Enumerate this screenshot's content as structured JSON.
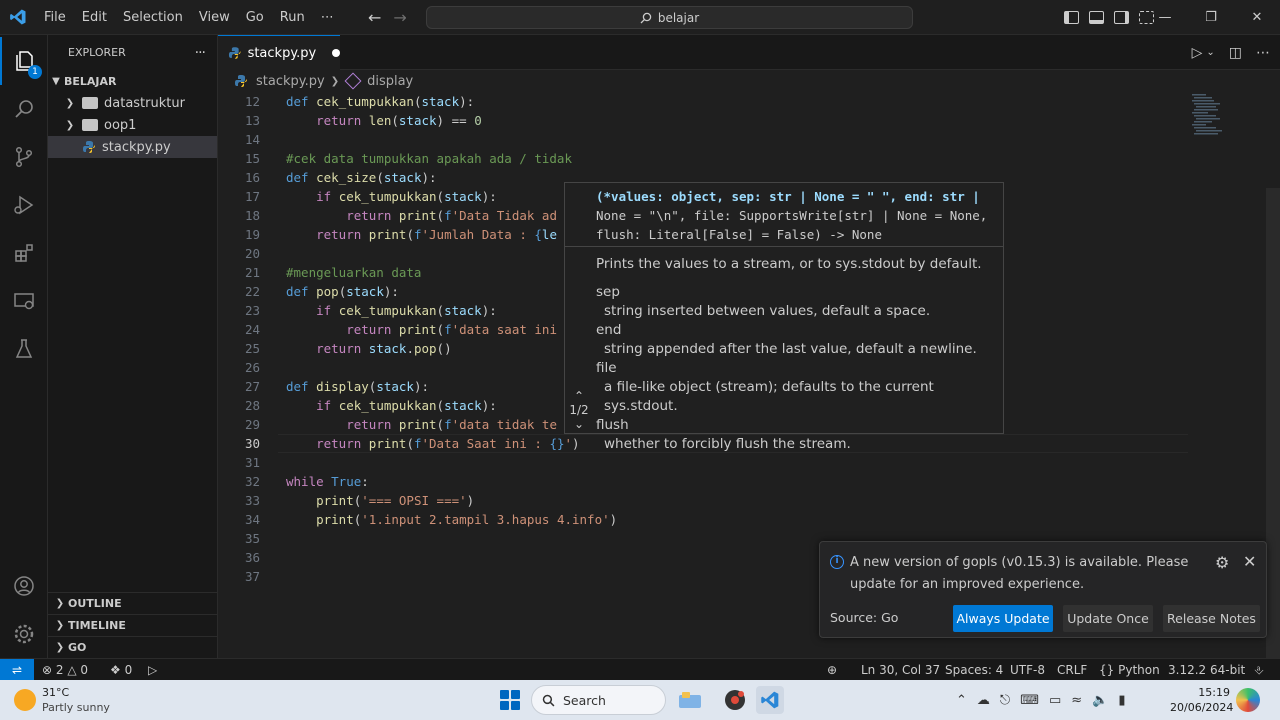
{
  "window": {
    "menu": [
      "File",
      "Edit",
      "Selection",
      "View",
      "Go",
      "Run",
      "⋯"
    ],
    "command_center": "belajar"
  },
  "activity": {
    "explorer_badge": "1"
  },
  "sidebar": {
    "title": "EXPLORER",
    "more": "···",
    "root": "BELAJAR",
    "items": [
      {
        "label": "datastruktur",
        "type": "folder"
      },
      {
        "label": "oop1",
        "type": "folder"
      },
      {
        "label": "stackpy.py",
        "type": "python-file"
      }
    ],
    "sections": [
      "OUTLINE",
      "TIMELINE",
      "GO"
    ]
  },
  "tab": {
    "label": "stackpy.py"
  },
  "breadcrumb": {
    "file": "stackpy.py",
    "symbol": "display"
  },
  "editor": {
    "cursor_line": 30,
    "lines": [
      {
        "n": "12",
        "tokens": [
          [
            "kw",
            "def "
          ],
          [
            "fn",
            "cek_tumpukkan"
          ],
          [
            "p",
            "("
          ],
          [
            "var",
            "stack"
          ],
          [
            "p",
            "):"
          ]
        ]
      },
      {
        "n": "13",
        "tokens": [
          [
            "p",
            "    "
          ],
          [
            "ctl",
            "return "
          ],
          [
            "fn",
            "len"
          ],
          [
            "p",
            "("
          ],
          [
            "var",
            "stack"
          ],
          [
            "p",
            ") == "
          ],
          [
            "num",
            "0"
          ]
        ]
      },
      {
        "n": "14",
        "tokens": []
      },
      {
        "n": "15",
        "tokens": [
          [
            "cmt",
            "#cek data tumpukkan apakah ada / tidak"
          ]
        ]
      },
      {
        "n": "16",
        "tokens": [
          [
            "kw",
            "def "
          ],
          [
            "fn",
            "cek_size"
          ],
          [
            "p",
            "("
          ],
          [
            "var",
            "stack"
          ],
          [
            "p",
            "):"
          ]
        ]
      },
      {
        "n": "17",
        "tokens": [
          [
            "p",
            "    "
          ],
          [
            "ctl",
            "if "
          ],
          [
            "fn",
            "cek_tumpukkan"
          ],
          [
            "p",
            "("
          ],
          [
            "var",
            "stack"
          ],
          [
            "p",
            "):"
          ]
        ]
      },
      {
        "n": "18",
        "tokens": [
          [
            "p",
            "        "
          ],
          [
            "ctl",
            "return "
          ],
          [
            "fn",
            "print"
          ],
          [
            "p",
            "("
          ],
          [
            "kw",
            "f"
          ],
          [
            "str",
            "'Data Tidak ad"
          ]
        ]
      },
      {
        "n": "19",
        "tokens": [
          [
            "p",
            "    "
          ],
          [
            "ctl",
            "return "
          ],
          [
            "fn",
            "print"
          ],
          [
            "p",
            "("
          ],
          [
            "kw",
            "f"
          ],
          [
            "str",
            "'Jumlah Data : "
          ],
          [
            "kw",
            "{"
          ],
          [
            "var",
            "le"
          ]
        ]
      },
      {
        "n": "20",
        "tokens": []
      },
      {
        "n": "21",
        "tokens": [
          [
            "cmt",
            "#mengeluarkan data"
          ]
        ]
      },
      {
        "n": "22",
        "tokens": [
          [
            "kw",
            "def "
          ],
          [
            "fn",
            "pop"
          ],
          [
            "p",
            "("
          ],
          [
            "var",
            "stack"
          ],
          [
            "p",
            "):"
          ]
        ]
      },
      {
        "n": "23",
        "tokens": [
          [
            "p",
            "    "
          ],
          [
            "ctl",
            "if "
          ],
          [
            "fn",
            "cek_tumpukkan"
          ],
          [
            "p",
            "("
          ],
          [
            "var",
            "stack"
          ],
          [
            "p",
            "):"
          ]
        ]
      },
      {
        "n": "24",
        "tokens": [
          [
            "p",
            "        "
          ],
          [
            "ctl",
            "return "
          ],
          [
            "fn",
            "print"
          ],
          [
            "p",
            "("
          ],
          [
            "kw",
            "f"
          ],
          [
            "str",
            "'data saat ini"
          ]
        ]
      },
      {
        "n": "25",
        "tokens": [
          [
            "p",
            "    "
          ],
          [
            "ctl",
            "return "
          ],
          [
            "var",
            "stack"
          ],
          [
            "p",
            "."
          ],
          [
            "fn",
            "pop"
          ],
          [
            "p",
            "()"
          ]
        ]
      },
      {
        "n": "26",
        "tokens": []
      },
      {
        "n": "27",
        "tokens": [
          [
            "kw",
            "def "
          ],
          [
            "fn",
            "display"
          ],
          [
            "p",
            "("
          ],
          [
            "var",
            "stack"
          ],
          [
            "p",
            "):"
          ]
        ]
      },
      {
        "n": "28",
        "tokens": [
          [
            "p",
            "    "
          ],
          [
            "ctl",
            "if "
          ],
          [
            "fn",
            "cek_tumpukkan"
          ],
          [
            "p",
            "("
          ],
          [
            "var",
            "stack"
          ],
          [
            "p",
            "):"
          ]
        ]
      },
      {
        "n": "29",
        "tokens": [
          [
            "p",
            "        "
          ],
          [
            "ctl",
            "return "
          ],
          [
            "fn",
            "print"
          ],
          [
            "p",
            "("
          ],
          [
            "kw",
            "f"
          ],
          [
            "str",
            "'data tidak te"
          ]
        ]
      },
      {
        "n": "30",
        "tokens": [
          [
            "p",
            "    "
          ],
          [
            "ctl",
            "return "
          ],
          [
            "fn",
            "print"
          ],
          [
            "p",
            "("
          ],
          [
            "kw",
            "f"
          ],
          [
            "str",
            "'Data Saat ini : "
          ],
          [
            "kw",
            "{}"
          ],
          [
            "str",
            "'"
          ],
          [
            "p",
            ")"
          ]
        ]
      },
      {
        "n": "31",
        "tokens": []
      },
      {
        "n": "32",
        "tokens": [
          [
            "ctl",
            "while "
          ],
          [
            "kw",
            "True"
          ],
          [
            "p",
            ":"
          ]
        ]
      },
      {
        "n": "33",
        "tokens": [
          [
            "p",
            "    "
          ],
          [
            "fn",
            "print"
          ],
          [
            "p",
            "("
          ],
          [
            "str",
            "'=== OPSI ==='"
          ],
          [
            "p",
            ")"
          ]
        ]
      },
      {
        "n": "34",
        "tokens": [
          [
            "p",
            "    "
          ],
          [
            "fn",
            "print"
          ],
          [
            "p",
            "("
          ],
          [
            "str",
            "'1.input 2.tampil 3.hapus 4.info'"
          ],
          [
            "p",
            ")"
          ]
        ]
      },
      {
        "n": "35",
        "tokens": []
      },
      {
        "n": "36",
        "tokens": []
      },
      {
        "n": "37",
        "tokens": []
      }
    ]
  },
  "hover": {
    "signature": [
      "(*values: object, sep: str | None = \" \", end: str |",
      "None = \"\\n\", file: SupportsWrite[str] | None = None,",
      "flush: Literal[False] = False) -> None"
    ],
    "description": "Prints the values to a stream, or to sys.stdout by default.",
    "params": [
      {
        "name": "sep",
        "desc": "string inserted between values, default a space."
      },
      {
        "name": "end",
        "desc": "string appended after the last value, default a newline."
      },
      {
        "name": "file",
        "desc": "a file-like object (stream); defaults to the current sys.stdout."
      },
      {
        "name": "flush",
        "desc": "whether to forcibly flush the stream."
      }
    ],
    "pager": "1/2"
  },
  "notification": {
    "message": "A new version of gopls (v0.15.3) is available. Please update for an improved experience.",
    "source": "Source: Go",
    "buttons": [
      "Always Update",
      "Update Once",
      "Release Notes"
    ]
  },
  "statusbar": {
    "errors": "2",
    "warnings": "0",
    "ports": "0",
    "position": "Ln 30, Col 37",
    "spaces": "Spaces: 4",
    "encoding": "UTF-8",
    "eol": "CRLF",
    "language": "Python",
    "interpreter": "3.12.2 64-bit"
  },
  "taskbar": {
    "temperature": "31°C",
    "weather": "Partly sunny",
    "search": "Search",
    "time": "15:19",
    "date": "20/06/2024"
  },
  "colors": {
    "accent": "#0078d4",
    "keyword": "#569cd6",
    "function": "#dcdcaa",
    "string": "#ce9178",
    "comment": "#6a9955"
  }
}
